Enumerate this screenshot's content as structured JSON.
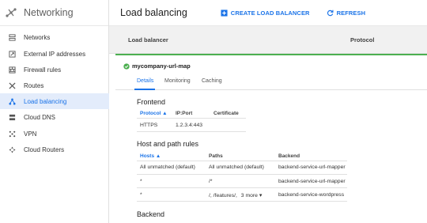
{
  "sidebar": {
    "title": "Networking",
    "items": [
      {
        "label": "Networks",
        "icon": "networks-icon"
      },
      {
        "label": "External IP addresses",
        "icon": "external-ip-icon"
      },
      {
        "label": "Firewall rules",
        "icon": "firewall-icon"
      },
      {
        "label": "Routes",
        "icon": "routes-icon"
      },
      {
        "label": "Load balancing",
        "icon": "load-balancing-icon",
        "active": true
      },
      {
        "label": "Cloud DNS",
        "icon": "dns-icon"
      },
      {
        "label": "VPN",
        "icon": "vpn-icon"
      },
      {
        "label": "Cloud Routers",
        "icon": "cloud-routers-icon"
      }
    ]
  },
  "header": {
    "title": "Load balancing",
    "create_label": "CREATE LOAD BALANCER",
    "refresh_label": "REFRESH"
  },
  "table": {
    "col_load_balancer": "Load balancer",
    "col_protocol": "Protocol"
  },
  "detail": {
    "name": "mycompany-url-map",
    "status_color": "#4caf50",
    "tabs": [
      "Details",
      "Monitoring",
      "Caching"
    ],
    "active_tab": "Details",
    "frontend": {
      "heading": "Frontend",
      "columns": [
        "Protocol",
        "IP:Port",
        "Certificate"
      ],
      "rows": [
        [
          "HTTPS",
          "1.2.3.4:443",
          ""
        ]
      ]
    },
    "host_path": {
      "heading": "Host and path rules",
      "columns": [
        "Hosts",
        "Paths",
        "Backend"
      ],
      "rows": [
        {
          "hosts": "All unmatched (default)",
          "paths": "All unmatched (default)",
          "more": "",
          "backend": "backend-service-url-mapper"
        },
        {
          "hosts": "*",
          "paths": "/*",
          "more": "",
          "backend": "backend-service-url-mapper"
        },
        {
          "hosts": "*",
          "paths": "/, /features/,",
          "more": "3 more",
          "backend": "backend-service-wordpress"
        }
      ]
    },
    "backend_heading": "Backend"
  },
  "colors": {
    "accent": "#1a73e8",
    "active_bg": "#e3ecfb",
    "success": "#4caf50"
  }
}
